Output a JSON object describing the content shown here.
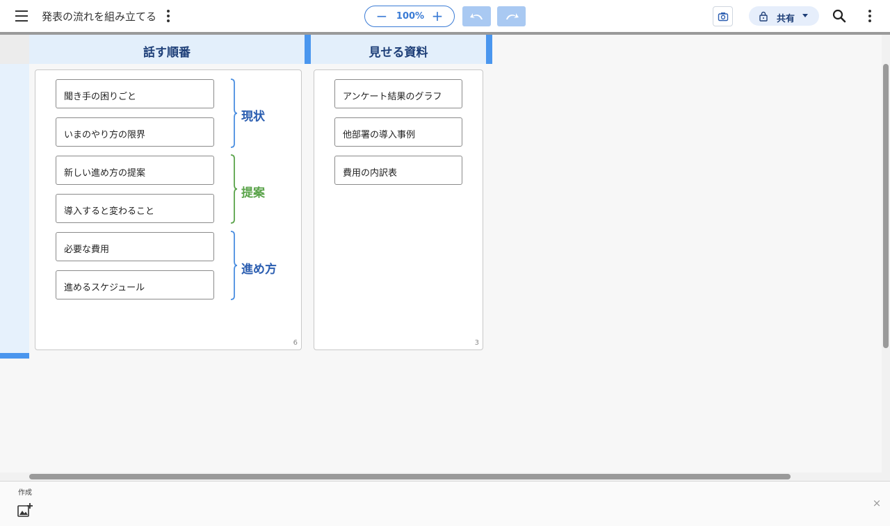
{
  "header": {
    "title": "発表の流れを組み立てる",
    "zoom": {
      "minus_label": "−",
      "value": "100%",
      "plus_label": "+"
    },
    "share_label": "共有",
    "icons": [
      "menu-icon",
      "more-vert-icon",
      "undo-icon",
      "redo-icon",
      "camera-icon",
      "lock-icon",
      "search-icon",
      "caret-down-icon"
    ]
  },
  "columns": [
    {
      "title": "話す順番",
      "count": "6",
      "cards": [
        "聞き手の困りごと",
        "いまのやり方の限界",
        "新しい進め方の提案",
        "導入すると変わること",
        "必要な費用",
        "進めるスケジュール"
      ],
      "groups": [
        {
          "label": "現状",
          "color": "#2a5db0"
        },
        {
          "label": "提案",
          "color": "#5aa34a"
        },
        {
          "label": "進め方",
          "color": "#2a5db0"
        }
      ]
    },
    {
      "title": "見せる資料",
      "count": "3",
      "cards": [
        "アンケート結果のグラフ",
        "他部署の導入事例",
        "費用の内訳表"
      ]
    }
  ],
  "tray": {
    "label": "作成",
    "add_icon": "add-image-icon",
    "close_label": "×"
  },
  "colors": {
    "accent": "#4a96ee",
    "header_text": "#1e3f78",
    "column_bg": "#e3effb"
  }
}
